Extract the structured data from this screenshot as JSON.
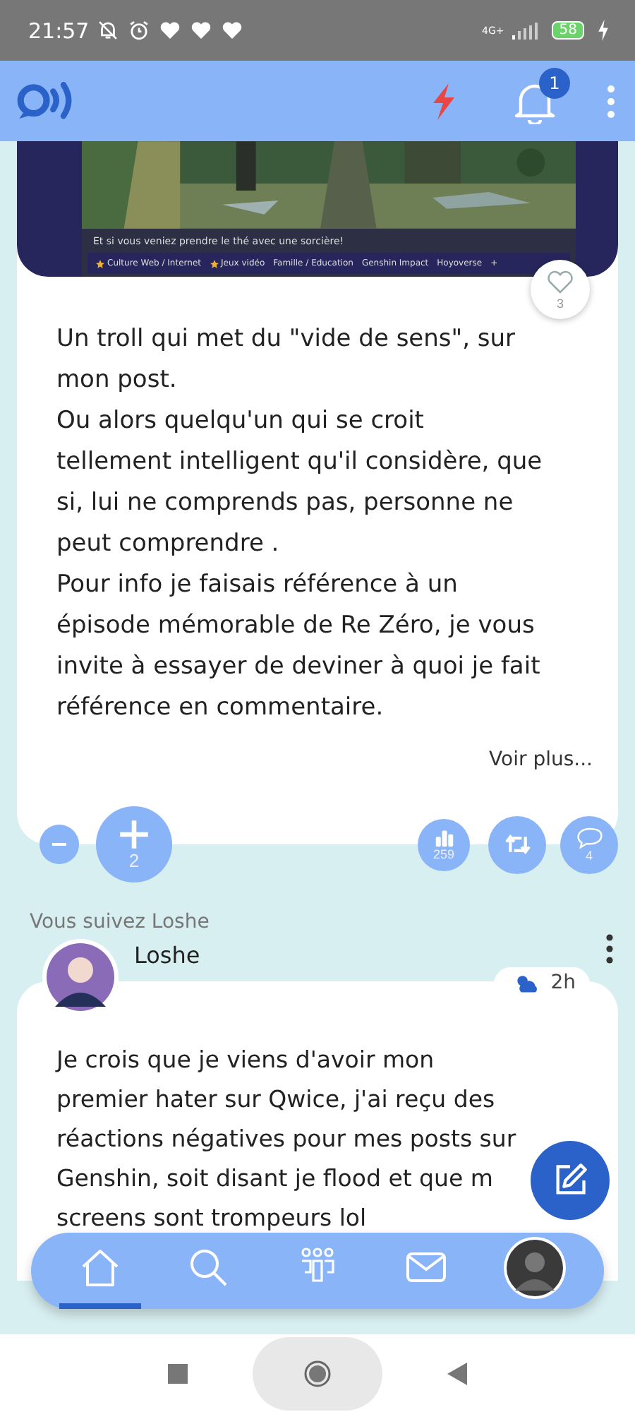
{
  "status_bar": {
    "time": "21:57",
    "network": "4G+",
    "battery": "58"
  },
  "app_bar": {
    "notifications": "1"
  },
  "posts": [
    {
      "embed": {
        "caption": "Et si vous veniez prendre le thé avec une sorcière!",
        "tags": [
          {
            "label": "Culture Web / Internet",
            "starred": true
          },
          {
            "label": "Jeux vidéo",
            "starred": true
          },
          {
            "label": "Famille / Education",
            "starred": false
          },
          {
            "label": "Genshin Impact",
            "starred": false
          },
          {
            "label": "Hoyoverse",
            "starred": false
          },
          {
            "label": "+",
            "starred": false
          }
        ]
      },
      "likes": "3",
      "paragraphs": [
        "Un troll qui met du \"vide de sens\", sur mon post.",
        "Ou alors quelqu'un qui se croit tellement intelligent qu'il considère, que si, lui ne comprends pas, personne ne peut comprendre .",
        "Pour info je faisais référence à un épisode mémorable de Re Zéro, je vous invite à essayer de deviner à quoi je fait référence en commentaire."
      ],
      "more": "Voir plus...",
      "votes": "2",
      "views": "259",
      "comments": "4"
    },
    {
      "context": "Vous suivez Loshe",
      "author": "Loshe",
      "time": "2h",
      "lines": [
        "Je crois que je viens d'avoir mon",
        "premier hater sur Qwice, j'ai reçu des",
        "réactions négatives pour mes posts sur",
        "Genshin, soit disant je flood et que m",
        "screens sont trompeurs lol"
      ]
    }
  ],
  "bottom_nav": [
    {
      "kind": "home",
      "selected": true
    },
    {
      "kind": "search",
      "selected": false
    },
    {
      "kind": "people",
      "selected": false
    },
    {
      "kind": "mail",
      "selected": false
    },
    {
      "kind": "profile",
      "selected": false
    }
  ]
}
